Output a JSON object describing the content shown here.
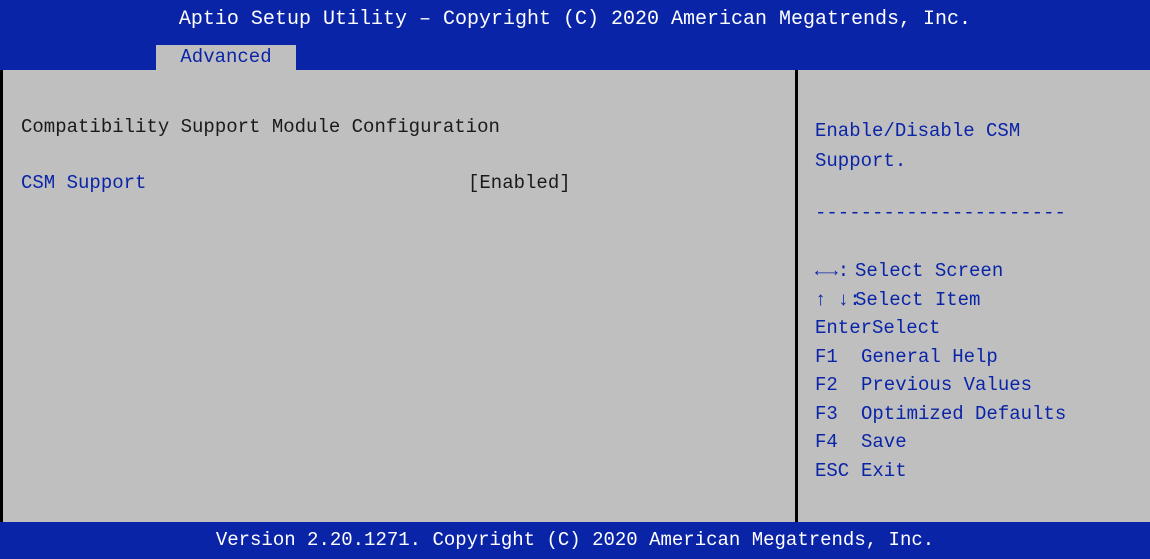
{
  "header": {
    "title": "Aptio Setup Utility – Copyright (C) 2020 American Megatrends, Inc."
  },
  "tabs": [
    {
      "label": "Advanced",
      "active": true
    }
  ],
  "main": {
    "section_title": "Compatibility Support Module Configuration",
    "items": [
      {
        "label": "CSM Support",
        "value": "[Enabled]"
      }
    ]
  },
  "help": {
    "description": "Enable/Disable CSM\nSupport.",
    "separator": "----------------------",
    "keys": [
      {
        "key": "←→:",
        "action": "Select Screen"
      },
      {
        "key": "↑ ↓:",
        "action": "Select Item"
      },
      {
        "key": "Enter",
        "action": "Select"
      },
      {
        "key": "F1",
        "action": "General Help"
      },
      {
        "key": "F2",
        "action": "Previous Values"
      },
      {
        "key": "F3",
        "action": "Optimized Defaults"
      },
      {
        "key": "F4",
        "action": "Save"
      },
      {
        "key": "ESC",
        "action": "Exit"
      }
    ]
  },
  "footer": {
    "text": "Version 2.20.1271. Copyright (C) 2020 American Megatrends, Inc."
  },
  "colors": {
    "header_blue": "#0a24a8",
    "panel_gray": "#bfbfbf",
    "text_blue": "#0a24a8",
    "text_dark": "#1a1a1a"
  }
}
